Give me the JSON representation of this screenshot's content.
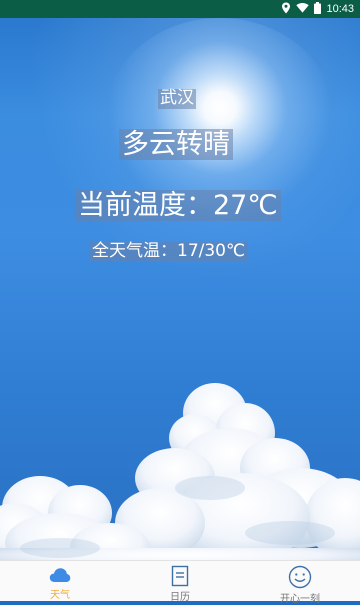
{
  "status_bar": {
    "time": "10:43",
    "icons": [
      "location-icon",
      "wifi-icon",
      "battery-icon"
    ],
    "background": "#0b5e45"
  },
  "weather": {
    "city": "武汉",
    "condition": "多云转晴",
    "current_temp": "当前温度：27℃",
    "day_range": "全天气温：17/30℃"
  },
  "tabs": [
    {
      "label": "天气",
      "icon": "cloud-icon",
      "active": true
    },
    {
      "label": "日历",
      "icon": "calendar-icon",
      "active": false
    },
    {
      "label": "开心一刻",
      "icon": "smiley-icon",
      "active": false
    }
  ],
  "colors": {
    "accent": "#f5a93a",
    "active_icon": "#3d8be4",
    "inactive": "#777777"
  }
}
